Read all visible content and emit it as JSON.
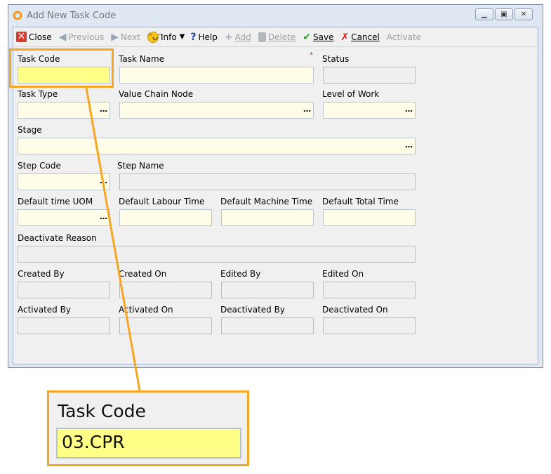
{
  "window": {
    "title": "Add New Task Code",
    "buttons": [
      "minimize",
      "maximize",
      "close"
    ]
  },
  "toolbar": {
    "close": "Close",
    "previous": "Previous",
    "next": "Next",
    "info": "Info",
    "help": "Help",
    "add": "Add",
    "delete": "Delete",
    "save": "Save",
    "cancel": "Cancel",
    "activate": "Activate"
  },
  "form": {
    "task_code": {
      "label": "Task Code",
      "value": ""
    },
    "task_name": {
      "label": "Task Name",
      "value": "",
      "required_mark": "*"
    },
    "status": {
      "label": "Status",
      "value": ""
    },
    "task_type": {
      "label": "Task Type",
      "value": ""
    },
    "value_chain_node": {
      "label": "Value Chain Node",
      "value": ""
    },
    "level_of_work": {
      "label": "Level of Work",
      "value": ""
    },
    "stage": {
      "label": "Stage",
      "value": ""
    },
    "step_code": {
      "label": "Step Code",
      "value": ""
    },
    "step_name": {
      "label": "Step Name",
      "value": ""
    },
    "default_time_uom": {
      "label": "Default time UOM",
      "value": ""
    },
    "default_labour_time": {
      "label": "Default Labour Time",
      "value": ""
    },
    "default_machine_time": {
      "label": "Default Machine Time",
      "value": ""
    },
    "default_total_time": {
      "label": "Default Total Time",
      "value": ""
    },
    "deactivate_reason": {
      "label": "Deactivate Reason",
      "value": ""
    },
    "created_by": {
      "label": "Created By",
      "value": ""
    },
    "created_on": {
      "label": "Created On",
      "value": ""
    },
    "edited_by": {
      "label": "Edited By",
      "value": ""
    },
    "edited_on": {
      "label": "Edited On",
      "value": ""
    },
    "activated_by": {
      "label": "Activated By",
      "value": ""
    },
    "activated_on": {
      "label": "Activated On",
      "value": ""
    },
    "deactivated_by": {
      "label": "Deactivated By",
      "value": ""
    },
    "deactivated_on": {
      "label": "Deactivated On",
      "value": ""
    },
    "lookup_glyph": "…"
  },
  "callout": {
    "label": "Task Code",
    "value": "03.CPR"
  },
  "colors": {
    "highlight": "#f5a623",
    "field_yellow": "#ffff88",
    "field_editable": "#fffde7",
    "field_readonly": "#efefef"
  }
}
